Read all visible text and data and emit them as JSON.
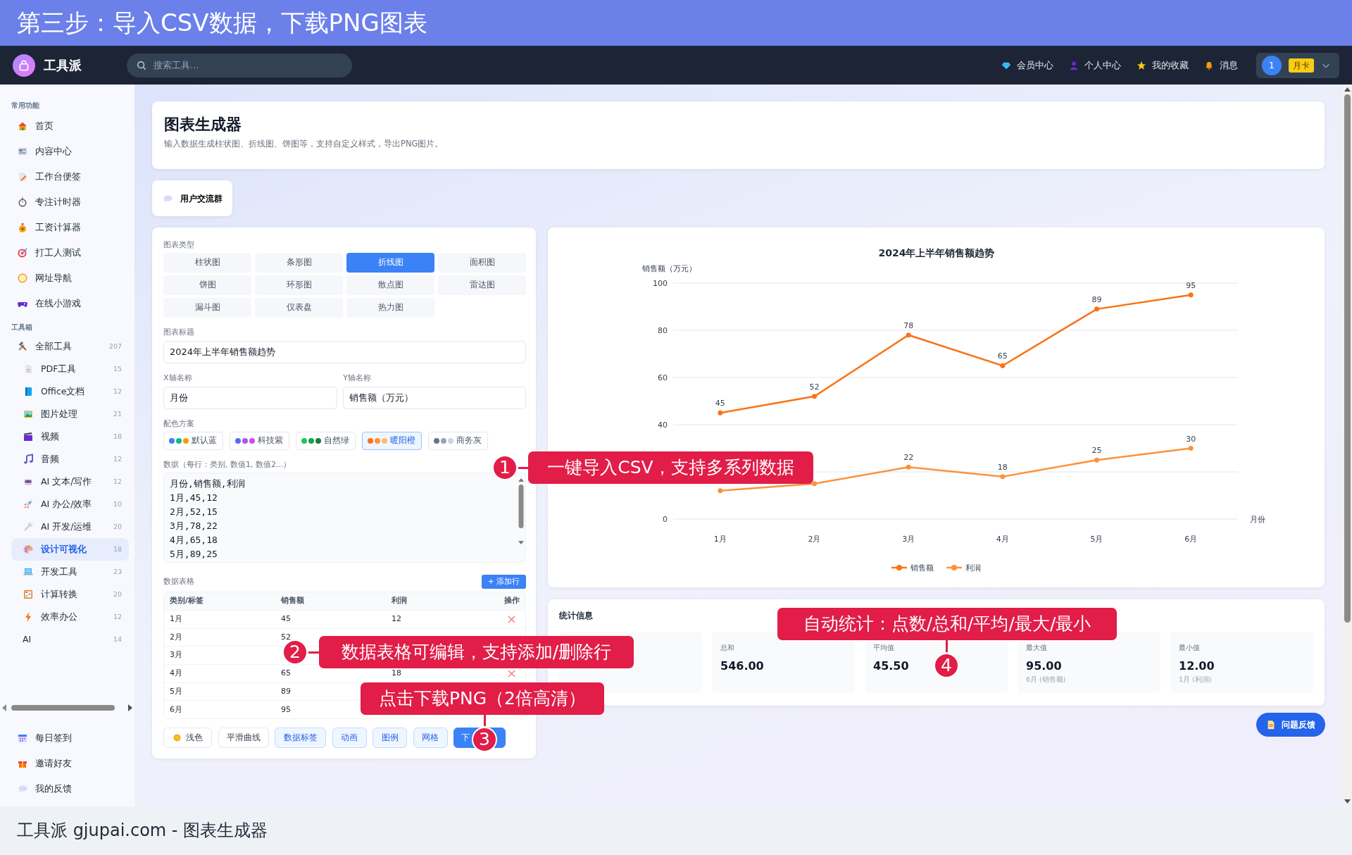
{
  "banner": {
    "title": "第三步：导入CSV数据，下载PNG图表"
  },
  "navbar": {
    "brand": "工具派",
    "search": {
      "placeholder": "搜索工具..."
    },
    "links": [
      "会员中心",
      "个人中心",
      "我的收藏",
      "消息"
    ],
    "user": {
      "avatar": "1",
      "badge": "月卡"
    }
  },
  "sidebar": {
    "sections": [
      {
        "title": "常用功能",
        "items": [
          {
            "kind": "icon",
            "label": "首页",
            "selected": false
          },
          {
            "kind": "icon",
            "label": "内容中心",
            "selected": false
          },
          {
            "kind": "icon",
            "label": "工作台便签",
            "selected": false
          },
          {
            "kind": "icon",
            "label": "专注计时器",
            "selected": false
          },
          {
            "kind": "icon",
            "label": "工资计算器",
            "selected": false
          },
          {
            "kind": "icon",
            "label": "打工人测试",
            "selected": false
          },
          {
            "kind": "icon",
            "label": "网址导航",
            "selected": false
          },
          {
            "kind": "icon",
            "label": "在线小游戏",
            "selected": false
          }
        ]
      },
      {
        "title": "工具箱",
        "items": [
          {
            "kind": "icon",
            "label": "全部工具",
            "count": "207",
            "selected": false,
            "children": [
              {
                "kind": "icon",
                "label": "PDF工具",
                "count": "15",
                "selected": false
              },
              {
                "kind": "icon",
                "label": "Office文档",
                "count": "12",
                "selected": false
              },
              {
                "kind": "icon",
                "label": "图片处理",
                "count": "21",
                "selected": false
              },
              {
                "kind": "icon",
                "label": "视频",
                "count": "18",
                "selected": false
              },
              {
                "kind": "icon",
                "label": "音频",
                "count": "12",
                "selected": false
              },
              {
                "kind": "icon",
                "label": "AI 文本/写作",
                "count": "12",
                "selected": false
              },
              {
                "kind": "icon",
                "label": "AI 办公/效率",
                "count": "10",
                "selected": false
              },
              {
                "kind": "icon",
                "label": "AI 开发/运维",
                "count": "20",
                "selected": false
              },
              {
                "kind": "icon",
                "label": "设计可视化",
                "count": "18",
                "selected": true
              },
              {
                "kind": "icon",
                "label": "开发工具",
                "count": "23",
                "selected": false
              },
              {
                "kind": "icon",
                "label": "计算转换",
                "count": "20",
                "selected": false
              },
              {
                "kind": "icon",
                "label": "效率办公",
                "count": "12",
                "selected": false
              }
            ]
          },
          {
            "kind": "plain",
            "label": "AI",
            "count": "14",
            "selected": false
          }
        ]
      }
    ],
    "footer_items": [
      "每日签到",
      "邀请好友",
      "我的反馈"
    ]
  },
  "page_header": {
    "title": "图表生成器",
    "subtitle": "输入数据生成柱状图、折线图、饼图等，支持自定义样式，导出PNG图片。"
  },
  "group_button": "用户交流群",
  "editor": {
    "chart_type": {
      "label": "图表类型",
      "options": [
        {
          "label": "柱状图",
          "selected": false
        },
        {
          "label": "条形图",
          "selected": false
        },
        {
          "label": "折线图",
          "selected": true
        },
        {
          "label": "面积图",
          "selected": false
        },
        {
          "label": "饼图",
          "selected": false
        },
        {
          "label": "环形图",
          "selected": false
        },
        {
          "label": "散点图",
          "selected": false
        },
        {
          "label": "雷达图",
          "selected": false
        },
        {
          "label": "漏斗图",
          "selected": false
        },
        {
          "label": "仪表盘",
          "selected": false
        },
        {
          "label": "热力图",
          "selected": false
        }
      ]
    },
    "title_field": {
      "label": "图表标题",
      "value": "2024年上半年销售额趋势"
    },
    "x_field": {
      "label": "X轴名称",
      "value": "月份"
    },
    "y_field": {
      "label": "Y轴名称",
      "value": "销售额（万元）"
    },
    "palettes": {
      "label": "配色方案",
      "options": [
        {
          "label": "默认蓝",
          "selected": false,
          "dots": [
            {
              "color": "#3b82f6"
            },
            {
              "color": "#10b981"
            },
            {
              "color": "#f59e0b"
            }
          ]
        },
        {
          "label": "科技紫",
          "selected": false,
          "dots": [
            {
              "color": "#6366f1"
            },
            {
              "color": "#a855f7"
            },
            {
              "color": "#d946ef"
            }
          ]
        },
        {
          "label": "自然绿",
          "selected": false,
          "dots": [
            {
              "color": "#22c55e"
            },
            {
              "color": "#16a34a"
            },
            {
              "color": "#15803d"
            }
          ]
        },
        {
          "label": "暖阳橙",
          "selected": true,
          "dots": [
            {
              "color": "#f97316"
            },
            {
              "color": "#fb923c"
            },
            {
              "color": "#fdba74"
            }
          ]
        },
        {
          "label": "商务灰",
          "selected": false,
          "dots": [
            {
              "color": "#64748b"
            },
            {
              "color": "#94a3b8"
            },
            {
              "color": "#cbd5e1"
            }
          ]
        }
      ]
    },
    "data": {
      "label": "数据（每行：类别, 数值1, 数值2...）",
      "value": "月份,销售额,利润\n1月,45,12\n2月,52,15\n3月,78,22\n4月,65,18\n5月,89,25"
    },
    "table": {
      "label": "数据表格",
      "add_button": "+ 添加行",
      "columns": [
        "类别/标签",
        "销售额",
        "利润",
        "操作"
      ],
      "rows": [
        {
          "cells": [
            "1月",
            "45",
            "12"
          ],
          "delete_icon": true
        },
        {
          "cells": [
            "2月",
            "52",
            null
          ],
          "delete_icon": false
        },
        {
          "cells": [
            "3月",
            null,
            null
          ],
          "delete_icon": false
        },
        {
          "cells": [
            "4月",
            "65",
            "18"
          ],
          "delete_icon": true
        },
        {
          "cells": [
            "5月",
            "89",
            null
          ],
          "delete_icon": false
        },
        {
          "cells": [
            "6月",
            "95",
            null
          ],
          "delete_icon": false
        }
      ]
    },
    "options": [
      {
        "kind": "toggle",
        "label": "浅色",
        "on": false
      },
      {
        "kind": "toggle",
        "label": "平滑曲线",
        "on": false
      },
      {
        "kind": "toggle",
        "label": "数据标签",
        "on": true
      },
      {
        "kind": "toggle",
        "label": "动画",
        "on": true
      },
      {
        "kind": "toggle",
        "label": "图例",
        "on": true
      },
      {
        "kind": "toggle",
        "label": "网格",
        "on": true
      },
      {
        "kind": "primary",
        "label": "下"
      }
    ]
  },
  "chart": {
    "chart_data": {
      "type": "line",
      "title": "2024年上半年销售额趋势",
      "xlabel": "月份",
      "ylabel": "销售额（万元）",
      "categories": [
        "1月",
        "2月",
        "3月",
        "4月",
        "5月",
        "6月"
      ],
      "series": [
        {
          "name": "销售额",
          "color": "#f97316",
          "marker": "circle",
          "values": [
            45,
            52,
            78,
            65,
            89,
            95
          ]
        },
        {
          "name": "利润",
          "color": "#fb923c",
          "marker": "circle",
          "values": [
            12,
            15,
            22,
            18,
            25,
            30
          ]
        }
      ],
      "ylim": [
        0,
        100
      ],
      "yticks": [
        0,
        {
          "value": 20,
          "label": null
        },
        40,
        60,
        80,
        100
      ],
      "grid": true,
      "legend": true,
      "value_labels": [
        [
          "45",
          "52",
          "78",
          "65",
          "89",
          "95"
        ],
        [
          null,
          null,
          "22",
          "18",
          "25",
          "30"
        ]
      ]
    }
  },
  "stats": {
    "title": "统计信息",
    "cards": [
      {
        "kind": "covered"
      },
      {
        "kind": "stat",
        "label": "总和",
        "value": "546.00"
      },
      {
        "kind": "stat",
        "label": "平均值",
        "value": "45.50"
      },
      {
        "kind": "stat",
        "label": "最大值",
        "value": "95.00",
        "note": "6月 (销售额)"
      },
      {
        "kind": "stat",
        "label": "最小值",
        "value": "12.00",
        "note": "1月 (利润)"
      }
    ]
  },
  "feedback_button": "问题反馈",
  "callouts": [
    {
      "number": "1",
      "text": "一键导入CSV，支持多系列数据"
    },
    {
      "number": "2",
      "text": "数据表格可编辑，支持添加/删除行"
    },
    {
      "number": "3",
      "text": "点击下载PNG（2倍高清）"
    },
    {
      "number": "4",
      "text": "自动统计：点数/总和/平均/最大/最小"
    }
  ],
  "caption": "工具派 gjupai.com - 图表生成器"
}
